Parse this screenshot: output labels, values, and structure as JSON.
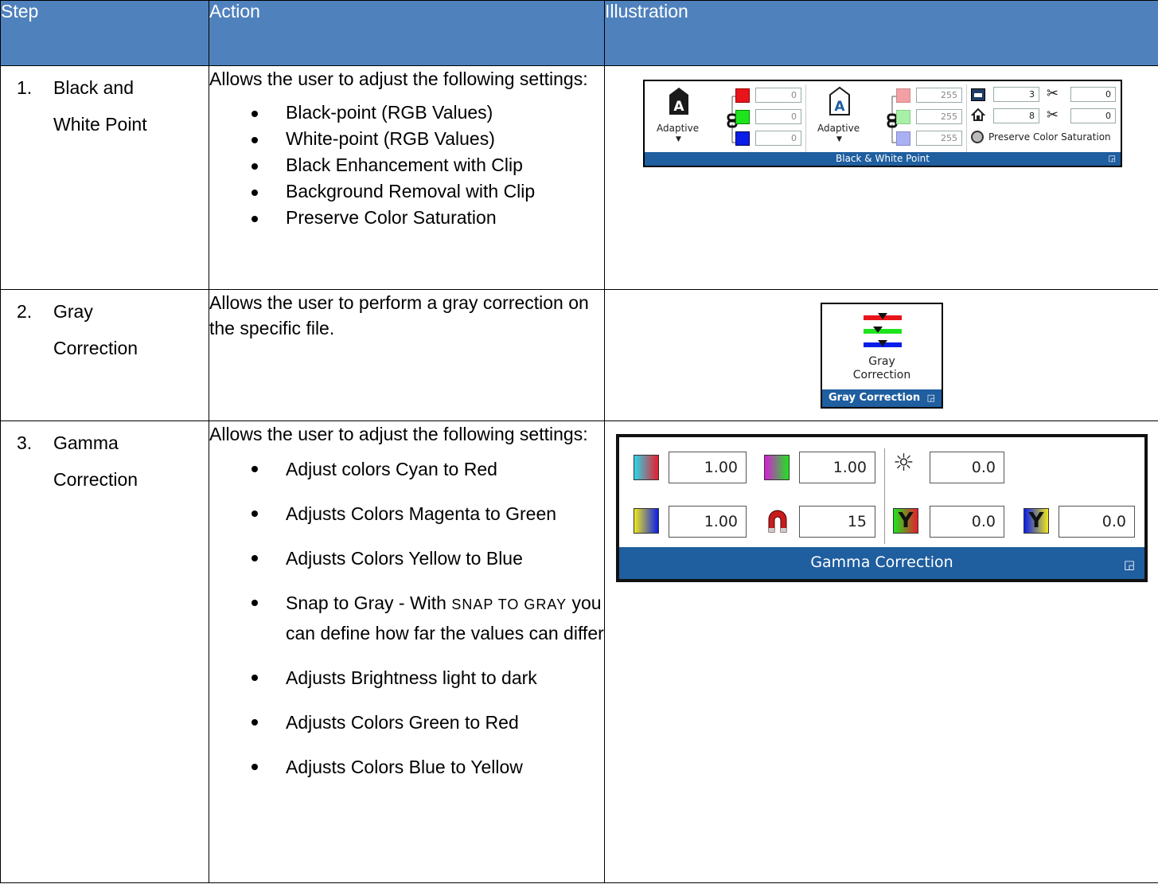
{
  "table": {
    "headers": [
      "Step",
      "Action",
      "Illustration"
    ],
    "rows": [
      {
        "num": "1.",
        "step_line1": "Black and",
        "step_line2": "White Point",
        "intro": "Allows the user to adjust the following settings:",
        "bullets": [
          "Black-point (RGB Values)",
          "White-point (RGB Values)",
          "Black Enhancement with Clip",
          "Background Removal with Clip",
          "Preserve Color Saturation"
        ]
      },
      {
        "num": "2.",
        "step_line1": "Gray",
        "step_line2": "Correction",
        "intro": "Allows the user to perform a gray correction on the specific file."
      },
      {
        "num": "3.",
        "step_line1": "Gamma",
        "step_line2": "Correction",
        "intro": "Allows the user to adjust the following settings:",
        "bullets": [
          "Adjust colors Cyan to Red",
          "Adjusts Colors Magenta to Green",
          "Adjusts Colors Yellow to Blue"
        ],
        "snap_prefix": "Snap to Gray - With ",
        "snap_sc": "SNAP TO GRAY",
        "snap_suffix": " you can define how far the values can differ",
        "bullets_after": [
          "Adjusts Brightness light to dark",
          "Adjusts Colors Green to Red",
          "Adjusts Colors Blue to Yellow"
        ]
      }
    ]
  },
  "bw_panel": {
    "black_label": "Adaptive",
    "white_label": "Adaptive",
    "black_rgb": [
      "0",
      "0",
      "0"
    ],
    "white_rgb": [
      "255",
      "255",
      "255"
    ],
    "enhance_value": "3",
    "enhance_clip": "0",
    "removal_value": "8",
    "removal_clip": "0",
    "preserve_label": "Preserve Color Saturation",
    "footer": "Black & White Point",
    "icons": [
      "black-point-icon",
      "white-point-icon",
      "link-icon",
      "black-enhance-icon",
      "background-removal-icon",
      "scissors-icon",
      "radio-icon",
      "dialog-launcher-icon"
    ],
    "colors": {
      "red": "#e8141c",
      "green": "#1ee41e",
      "blue": "#0b1ee8",
      "pink": "#f2a0a4",
      "light_green": "#a8f0a8",
      "lavender": "#aab0f4",
      "ribbon": "#1f5e9f"
    }
  },
  "gray_panel": {
    "label_line1": "Gray",
    "label_line2": "Correction",
    "footer": "Gray Correction",
    "icons": [
      "gray-correction-icon",
      "dialog-launcher-icon"
    ]
  },
  "gamma_panel": {
    "cyan_red": "1.00",
    "magenta_green": "1.00",
    "brightness": "0.0",
    "yellow_blue": "1.00",
    "snap_to_gray": "15",
    "green_red": "0.0",
    "blue_yellow": "0.0",
    "footer": "Gamma Correction",
    "icons": [
      "cyan-red-icon",
      "magenta-green-icon",
      "brightness-icon",
      "yellow-blue-icon",
      "magnet-icon",
      "green-red-icon",
      "blue-yellow-icon",
      "dialog-launcher-icon"
    ]
  }
}
